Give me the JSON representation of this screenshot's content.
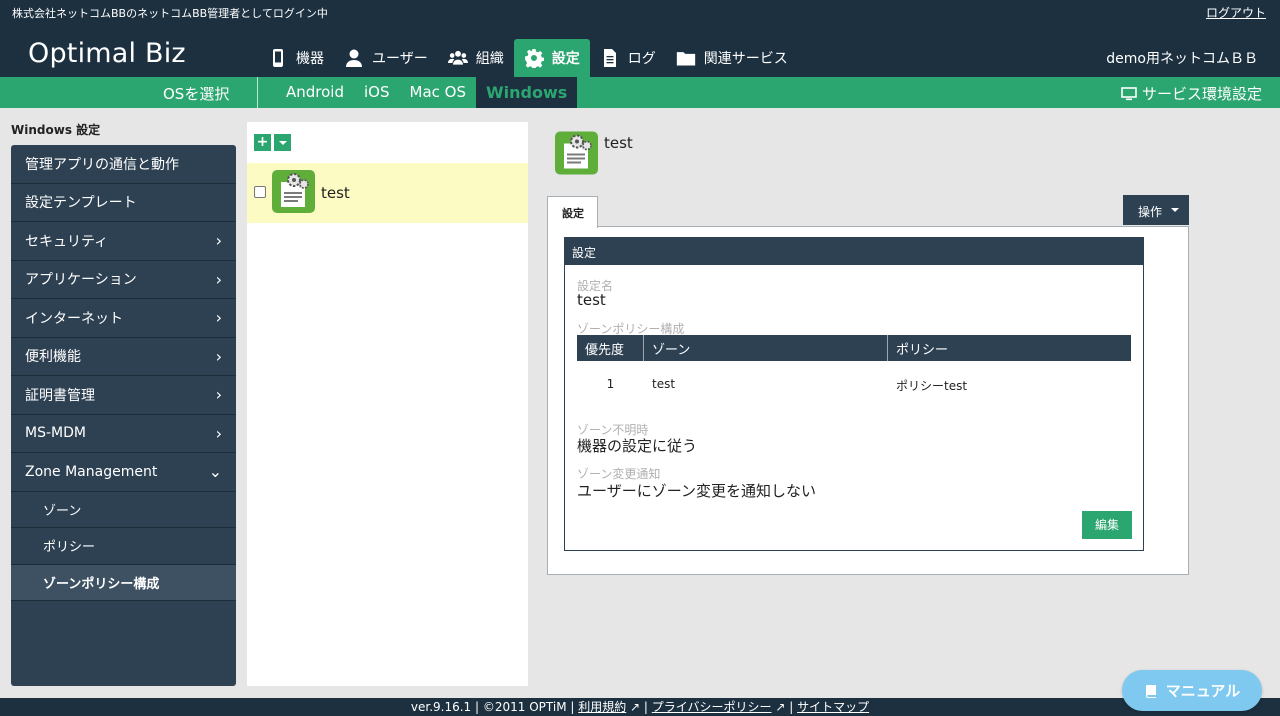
{
  "topbar": {
    "login_text": "株式会社ネットコムBBのネットコムBB管理者としてログイン中",
    "logout": "ログアウト"
  },
  "header": {
    "logo": "Optimal Biz",
    "nav": [
      {
        "label": "機器",
        "icon": "smartphone-icon"
      },
      {
        "label": "ユーザー",
        "icon": "user-icon"
      },
      {
        "label": "組織",
        "icon": "group-icon"
      },
      {
        "label": "設定",
        "icon": "gear-icon",
        "active": true
      },
      {
        "label": "ログ",
        "icon": "document-icon"
      },
      {
        "label": "関連サービス",
        "icon": "folder-icon"
      }
    ],
    "tenant": "demo用ネットコムＢＢ"
  },
  "subnav": {
    "os_select": "OSを選択",
    "tabs": [
      "Android",
      "iOS",
      "Mac OS",
      "Windows"
    ],
    "active_tab": "Windows",
    "service_settings": "サービス環境設定"
  },
  "sidebar": {
    "title": "Windows 設定",
    "items": [
      {
        "label": "管理アプリの通信と動作",
        "chevron": ""
      },
      {
        "label": "設定テンプレート",
        "chevron": ""
      },
      {
        "label": "セキュリティ",
        "chevron": "›"
      },
      {
        "label": "アプリケーション",
        "chevron": "›"
      },
      {
        "label": "インターネット",
        "chevron": "›"
      },
      {
        "label": "便利機能",
        "chevron": "›"
      },
      {
        "label": "証明書管理",
        "chevron": "›"
      },
      {
        "label": "MS-MDM",
        "chevron": "›"
      },
      {
        "label": "Zone Management",
        "chevron": "⌄"
      }
    ],
    "subitems": [
      "ゾーン",
      "ポリシー",
      "ゾーンポリシー構成"
    ],
    "active_sub": "ゾーンポリシー構成"
  },
  "list": {
    "add_label": "+",
    "items": [
      {
        "name": "test"
      }
    ]
  },
  "detail": {
    "name": "test",
    "tab": "設定",
    "ops": "操作",
    "section": "設定",
    "fields": {
      "setting_name_label": "設定名",
      "setting_name": "test",
      "zone_policy_label": "ゾーンポリシー構成",
      "zone_unknown_label": "ゾーン不明時",
      "zone_unknown": "機器の設定に従う",
      "zone_notify_label": "ゾーン変更通知",
      "zone_notify": "ユーザーにゾーン変更を通知しない"
    },
    "table": {
      "headers": [
        "優先度",
        "ゾーン",
        "ポリシー"
      ],
      "rows": [
        [
          "1",
          "test",
          "ポリシーtest"
        ]
      ]
    },
    "edit": "編集"
  },
  "footer": {
    "version": "ver.9.16.1 | ©2011 OPTiM | ",
    "terms": "利用規約",
    "privacy": "プライバシーポリシー",
    "sitemap": "サイトマップ",
    "sep": " | "
  },
  "manual": "マニュアル",
  "colors": {
    "navy": "#1d3040",
    "green": "#2ca671",
    "sidebar": "#2e4153",
    "highlight": "#fdfbc4",
    "manual": "#7fc8f0"
  }
}
